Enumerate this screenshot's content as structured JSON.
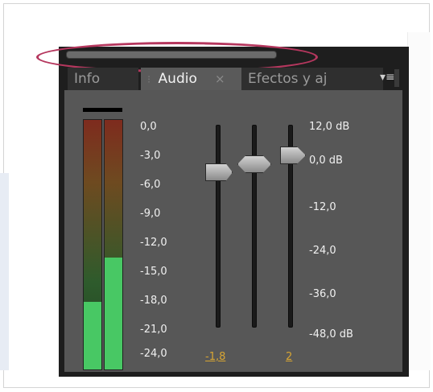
{
  "tabs": [
    {
      "label": "Info"
    },
    {
      "label": "Audio"
    },
    {
      "label": "Efectos y aj"
    }
  ],
  "icons": {
    "tab_close": "×",
    "panel_menu": "▾≡",
    "tab_grip": "⁝"
  },
  "meter": {
    "left_level": 0.27,
    "right_level": 0.45,
    "scale": [
      "0,0",
      "-3,0",
      "-6,0",
      "-9,0",
      "-12,0",
      "-15,0",
      "-18,0",
      "-21,0",
      "-24,0"
    ]
  },
  "faders": {
    "scale": [
      "12,0 dB",
      "0,0 dB",
      "-12,0",
      "-24,0",
      "-36,0",
      "-48,0 dB"
    ],
    "left_value": "-1,8",
    "right_value": "2"
  },
  "colors": {
    "highlight": "#b5375e",
    "value_text": "#d7a533",
    "meter_green": "#48c864"
  }
}
